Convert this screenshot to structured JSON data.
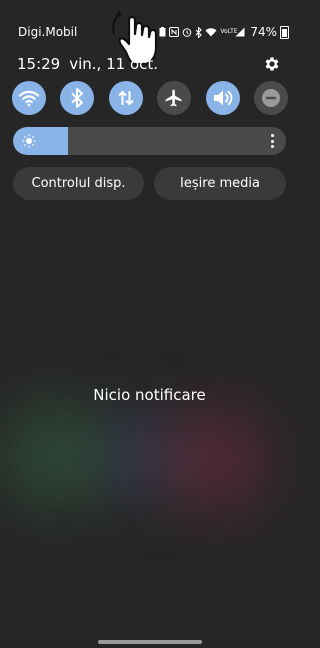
{
  "status_bar": {
    "carrier": "Digi.Mobil",
    "volte_label": "VoLTE",
    "battery_percent": "74%",
    "icons": [
      "battery-saver-icon",
      "nfc-icon",
      "alarm-icon",
      "bluetooth-icon",
      "wifi-icon",
      "volte-icon",
      "signal-icon",
      "battery-icon"
    ]
  },
  "header": {
    "time": "15:29",
    "date": "vin., 11 oct."
  },
  "quick_settings": {
    "tiles": [
      {
        "icon": "wifi-icon",
        "active": true
      },
      {
        "icon": "bluetooth-icon",
        "active": true
      },
      {
        "icon": "mobile-data-icon",
        "active": true
      },
      {
        "icon": "airplane-mode-icon",
        "active": false
      },
      {
        "icon": "sound-icon",
        "active": true
      },
      {
        "icon": "do-not-disturb-icon",
        "active": false
      }
    ],
    "active_color": "#8ab4e8",
    "inactive_color": "#4a4a4a"
  },
  "brightness": {
    "level": 0.2
  },
  "buttons": {
    "device_control": "Controlul disp.",
    "media_output": "Ieșire media"
  },
  "notifications": {
    "empty_text": "Nicio notificare"
  }
}
